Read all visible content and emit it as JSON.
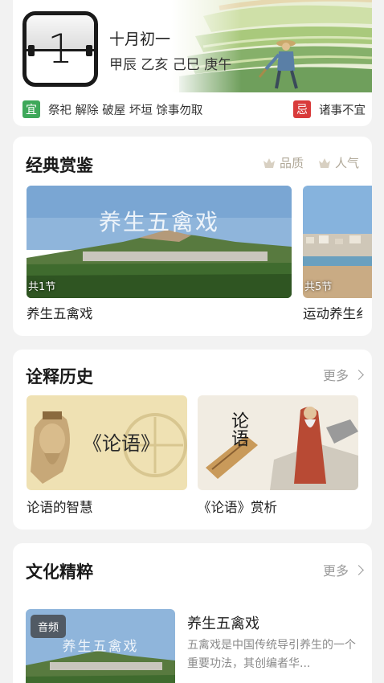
{
  "calendar": {
    "day": "1",
    "lunar_date": "十月初一",
    "ganzhi": "甲辰 乙亥 己巳 庚午",
    "yi_label": "宜",
    "yi_text": "祭祀 解除 破屋 坏垣 馀事勿取",
    "ji_label": "忌",
    "ji_text": "诸事不宜"
  },
  "classic": {
    "title": "经典赏鉴",
    "filters": [
      {
        "label": "品质",
        "icon": "crown-icon"
      },
      {
        "label": "人气",
        "icon": "crown-icon"
      }
    ],
    "items": [
      {
        "overlay": "养生五禽戏",
        "count": "共1节",
        "caption": "养生五禽戏"
      },
      {
        "count": "共5节",
        "caption": "运动养生纟"
      }
    ]
  },
  "history": {
    "title": "诠释历史",
    "more": "更多",
    "items": [
      {
        "overlay": "《论语》",
        "caption": "论语的智慧"
      },
      {
        "overlay": "论语",
        "caption": "《论语》赏析"
      }
    ]
  },
  "culture": {
    "title": "文化精粹",
    "more": "更多",
    "item": {
      "badge": "音频",
      "overlay": "养生五禽戏",
      "title": "养生五禽戏",
      "desc": "五禽戏是中国传统导引养生的一个重要功法，其创编者华..."
    }
  },
  "colors": {
    "accent_green": "#3ea85a",
    "accent_red": "#d93b3b",
    "background": "#f2f2f2"
  }
}
